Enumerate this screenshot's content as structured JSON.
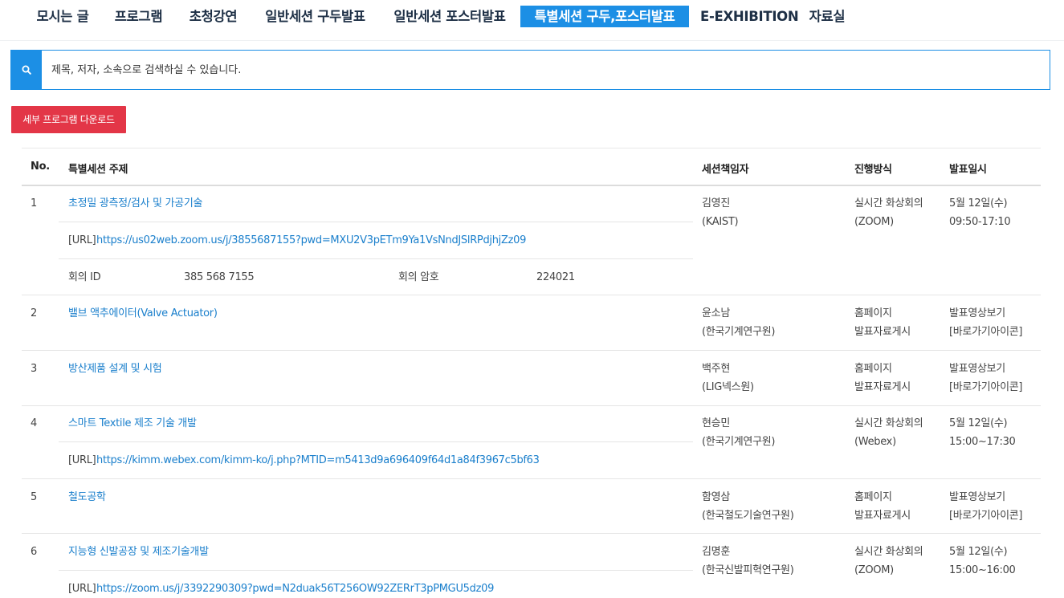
{
  "nav": {
    "items": [
      {
        "label": "모시는 글"
      },
      {
        "label": "프로그램"
      },
      {
        "label": "초청강연"
      },
      {
        "label": "일반세션 구두발표"
      },
      {
        "label": "일반세션 포스터발표"
      },
      {
        "label": "특별세션 구두,포스터발표"
      },
      {
        "label": "E-EXHIBITION"
      },
      {
        "label": "자료실"
      }
    ],
    "active_index": 5,
    "accent_color": "#1c8fe5"
  },
  "search": {
    "placeholder": "제목, 저자, 소속으로 검색하실 수 있습니다.",
    "icon": "search-icon"
  },
  "download_button": {
    "label": "세부 프로그램 다운로드",
    "color": "#e33647"
  },
  "table": {
    "headers": {
      "no": "No.",
      "topic": "특별세션 주제",
      "chair": "세션책임자",
      "method": "진행방식",
      "date": "발표일시"
    },
    "rows": [
      {
        "no": "1",
        "title": "초정밀 광측정/검사 및 가공기술",
        "url_label": "[URL]",
        "url": "https://us02web.zoom.us/j/3855687155?pwd=MXU2V3pETm9Ya1VsNndJSlRPdjhjZz09",
        "meeting_id_label": "회의 ID",
        "meeting_id": "385 568 7155",
        "password_label": "회의 암호",
        "password": "224021",
        "chair_name": "김영진",
        "chair_org": "(KAIST)",
        "method_1": "실시간 화상회의",
        "method_2": "(ZOOM)",
        "date_1": "5월 12일(수)",
        "date_2": "09:50-17:10"
      },
      {
        "no": "2",
        "title": "밸브 액추에이터(Valve Actuator)",
        "chair_name": "윤소남",
        "chair_org": "(한국기계연구원)",
        "method_1": "홈페이지",
        "method_2": "발표자료게시",
        "date_1": "발표영상보기",
        "date_2": "[바로가기아이콘]"
      },
      {
        "no": "3",
        "title": "방산제품 설계 및 시험",
        "chair_name": "백주현",
        "chair_org": "(LIG넥스원)",
        "method_1": "홈페이지",
        "method_2": "발표자료게시",
        "date_1": "발표영상보기",
        "date_2": "[바로가기아이콘]"
      },
      {
        "no": "4",
        "title": "스마트 Textile 제조 기술 개발",
        "url_label": "[URL]",
        "url": "https://kimm.webex.com/kimm-ko/j.php?MTID=m5413d9a696409f64d1a84f3967c5bf63",
        "chair_name": "현승민",
        "chair_org": "(한국기계연구원)",
        "method_1": "실시간 화상회의",
        "method_2": "(Webex)",
        "date_1": "5월 12일(수)",
        "date_2": "15:00~17:30"
      },
      {
        "no": "5",
        "title": "철도공학",
        "chair_name": "함영삼",
        "chair_org": "(한국철도기술연구원)",
        "method_1": "홈페이지",
        "method_2": "발표자료게시",
        "date_1": "발표영상보기",
        "date_2": "[바로가기아이콘]"
      },
      {
        "no": "6",
        "title": "지능형 신발공장 및 제조기술개발",
        "url_label": "[URL]",
        "url": "https://zoom.us/j/3392290309?pwd=N2duak56T256OW92ZERrT3pPMGU5dz09",
        "chair_name": "김명훈",
        "chair_org": "(한국신발피혁연구원)",
        "method_1": "실시간 화상회의",
        "method_2": "(ZOOM)",
        "date_1": "5월 12일(수)",
        "date_2": "15:00~16:00"
      }
    ]
  }
}
